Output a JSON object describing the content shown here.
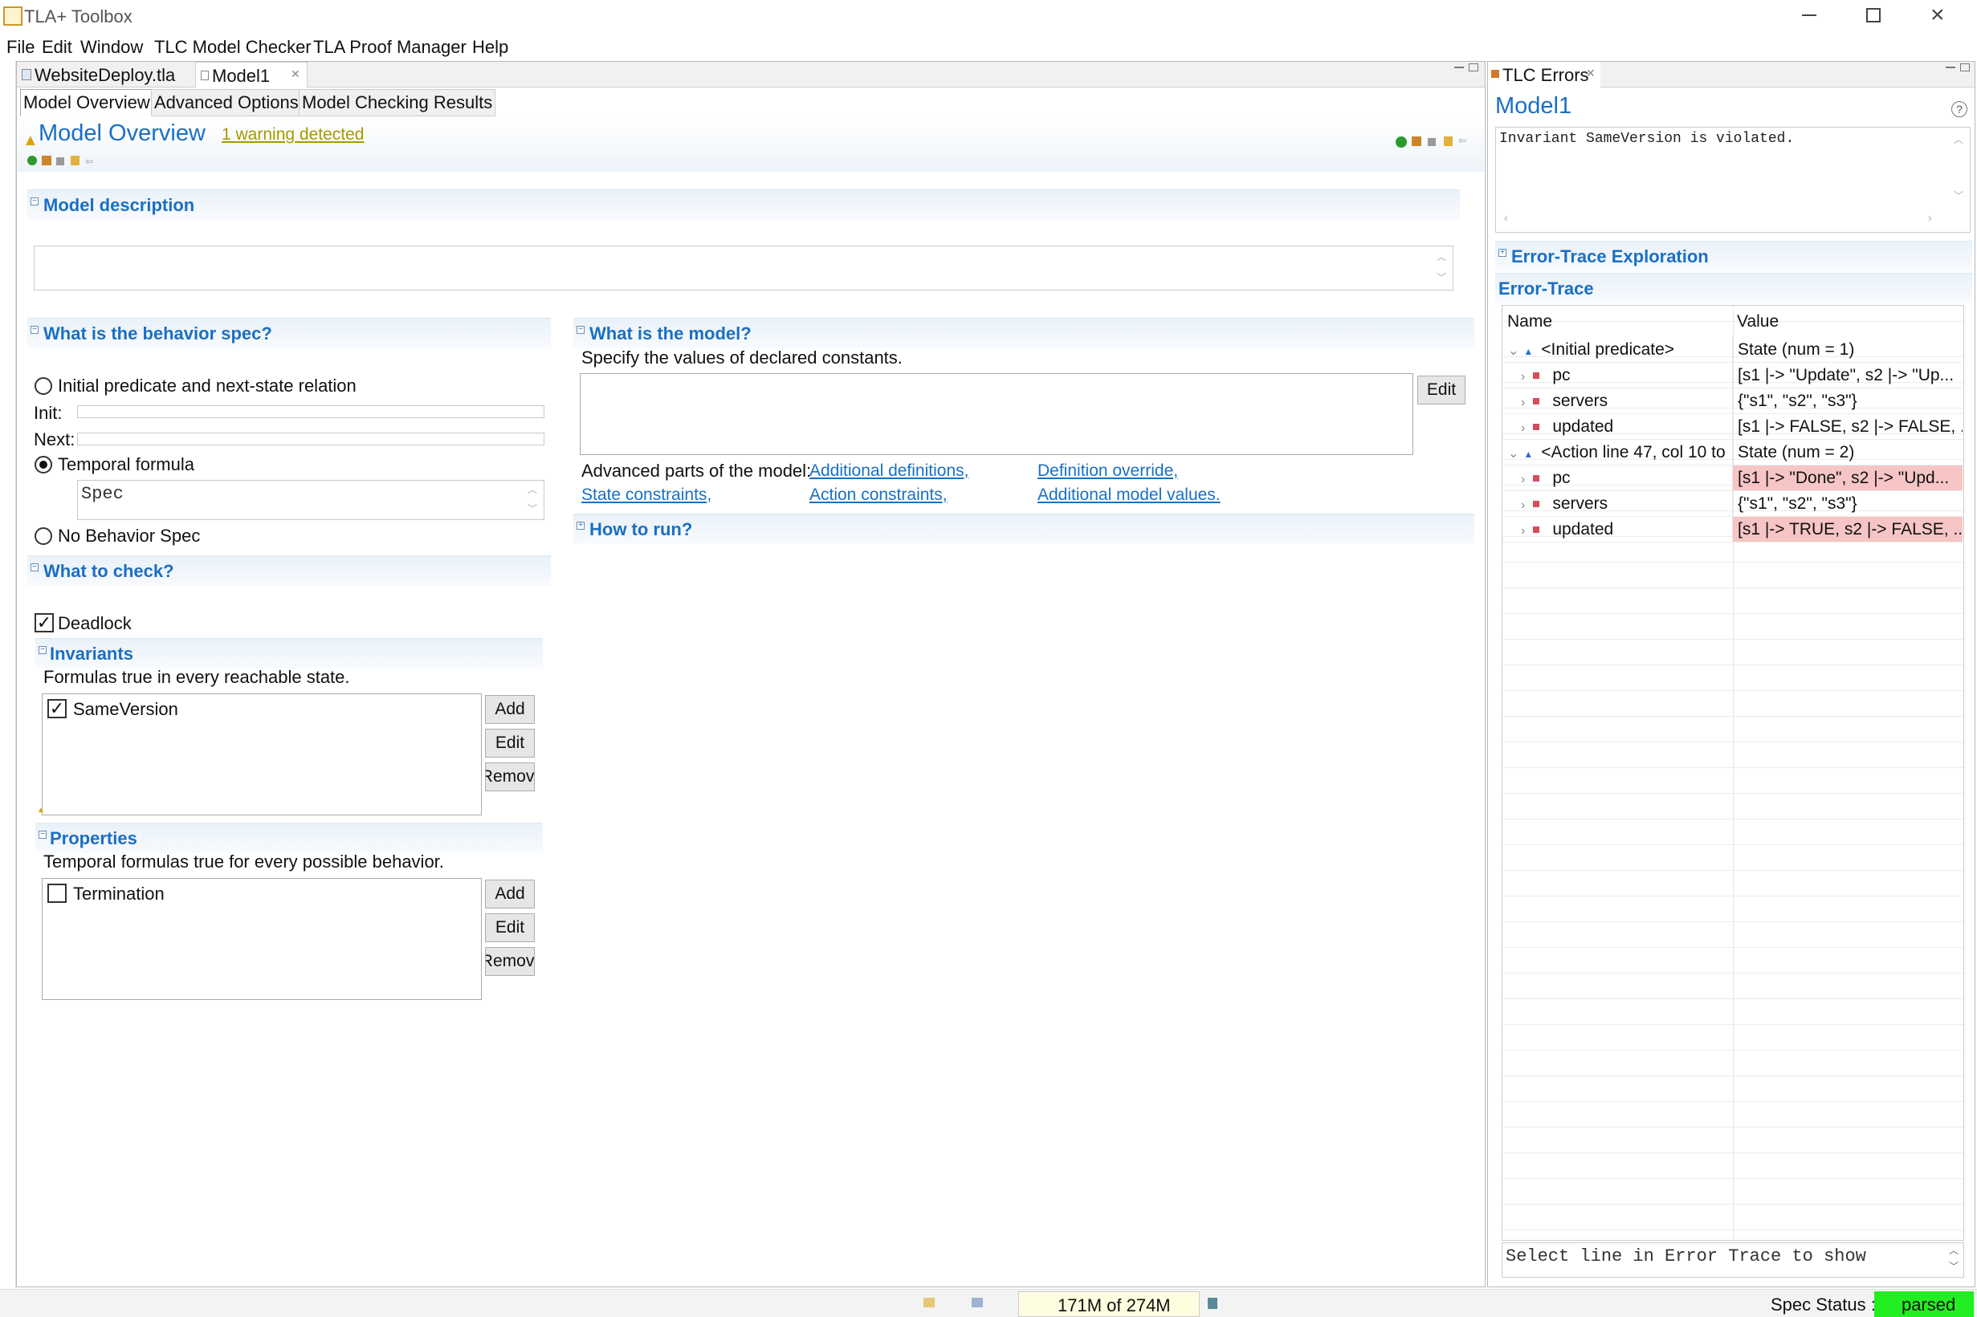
{
  "window": {
    "title": "TLA+ Toolbox"
  },
  "menu": [
    "File",
    "Edit",
    "Window",
    "TLC Model Checker",
    "TLA Proof Manager",
    "Help"
  ],
  "editor_tabs": [
    "WebsiteDeploy.tla",
    "Model1"
  ],
  "page_tabs": [
    "Model Overview",
    "Advanced Options",
    "Model Checking Results"
  ],
  "overview": {
    "title": "Model Overview",
    "warning": "1 warning detected"
  },
  "model_description": {
    "header": "Model description",
    "value": ""
  },
  "behavior": {
    "header": "What is the behavior spec?",
    "option_init_next": "Initial predicate and next-state relation",
    "init_label": "Init:",
    "next_label": "Next:",
    "option_temporal": "Temporal formula",
    "temporal_value": "Spec",
    "option_none": "No Behavior Spec"
  },
  "check": {
    "header": "What to check?",
    "deadlock": "Deadlock",
    "invariants_header": "Invariants",
    "invariants_desc": "Formulas true in every reachable state.",
    "invariants": [
      {
        "name": "SameVersion",
        "checked": true
      }
    ],
    "properties_header": "Properties",
    "properties_desc": "Temporal formulas true for every possible behavior.",
    "properties": [
      {
        "name": "Termination",
        "checked": false
      }
    ],
    "add": "Add",
    "edit": "Edit",
    "remove": "Remove"
  },
  "model": {
    "header": "What is the model?",
    "desc": "Specify the values of declared constants.",
    "edit": "Edit",
    "advanced_label": "Advanced parts of the model:",
    "links": [
      "Additional definitions,",
      "Definition override,",
      "State constraints,",
      "Action constraints,",
      "Additional model values."
    ],
    "how_to_run": "How to run?"
  },
  "errors_panel": {
    "tab": "TLC Errors",
    "title": "Model1",
    "message": "Invariant SameVersion is violated.",
    "exploration": "Error-Trace Exploration",
    "trace_header": "Error-Trace",
    "col_name": "Name",
    "col_value": "Value",
    "rows": [
      {
        "name": "<Initial predicate>",
        "value": "State (num = 1)",
        "level": 0,
        "highlight": false
      },
      {
        "name": "pc",
        "value": "[s1 |-> \"Update\", s2 |-> \"Up...",
        "level": 1,
        "highlight": false
      },
      {
        "name": "servers",
        "value": "{\"s1\", \"s2\", \"s3\"}",
        "level": 1,
        "highlight": false
      },
      {
        "name": "updated",
        "value": "[s1 |-> FALSE, s2 |-> FALSE, ...",
        "level": 1,
        "highlight": false
      },
      {
        "name": "<Action line 47, col 10 to",
        "value": "State (num = 2)",
        "level": 0,
        "highlight": false
      },
      {
        "name": "pc",
        "value": "[s1 |-> \"Done\", s2 |-> \"Upd...",
        "level": 1,
        "highlight": true
      },
      {
        "name": "servers",
        "value": "{\"s1\", \"s2\", \"s3\"}",
        "level": 1,
        "highlight": false
      },
      {
        "name": "updated",
        "value": "[s1 |-> TRUE, s2 |-> FALSE, ...",
        "level": 1,
        "highlight": true
      }
    ],
    "detail_placeholder": "Select line in Error Trace to show"
  },
  "status": {
    "memory": "171M of 274M",
    "spec_status_label": "Spec Status :",
    "spec_status_value": "parsed",
    "spec_status_color": "#22ee22"
  }
}
